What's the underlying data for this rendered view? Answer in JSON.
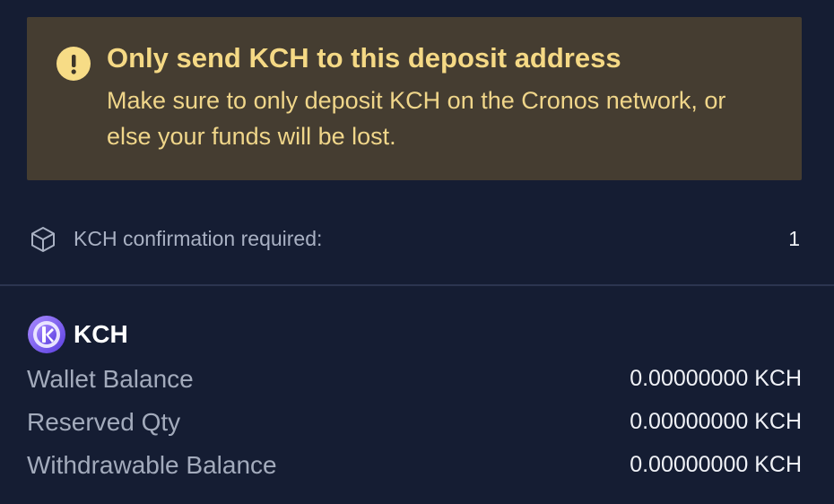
{
  "warning": {
    "icon": "exclamation-icon",
    "title": "Only send KCH to this deposit address",
    "body": "Make sure to only deposit KCH on the Cronos network, or else your funds will be lost.",
    "background": "#453d31",
    "accent": "#f5d985"
  },
  "confirmation": {
    "icon": "box-icon",
    "label": "KCH confirmation required:",
    "value": "1"
  },
  "coin": {
    "icon": "kch-logo-icon",
    "symbol": "KCH"
  },
  "balances": [
    {
      "label": "Wallet Balance",
      "value": "0.00000000 KCH"
    },
    {
      "label": "Reserved Qty",
      "value": "0.00000000 KCH"
    },
    {
      "label": "Withdrawable Balance",
      "value": "0.00000000 KCH"
    }
  ],
  "colors": {
    "background": "#151d33",
    "divider": "#2c3550",
    "muted_text": "#a3abbc"
  }
}
